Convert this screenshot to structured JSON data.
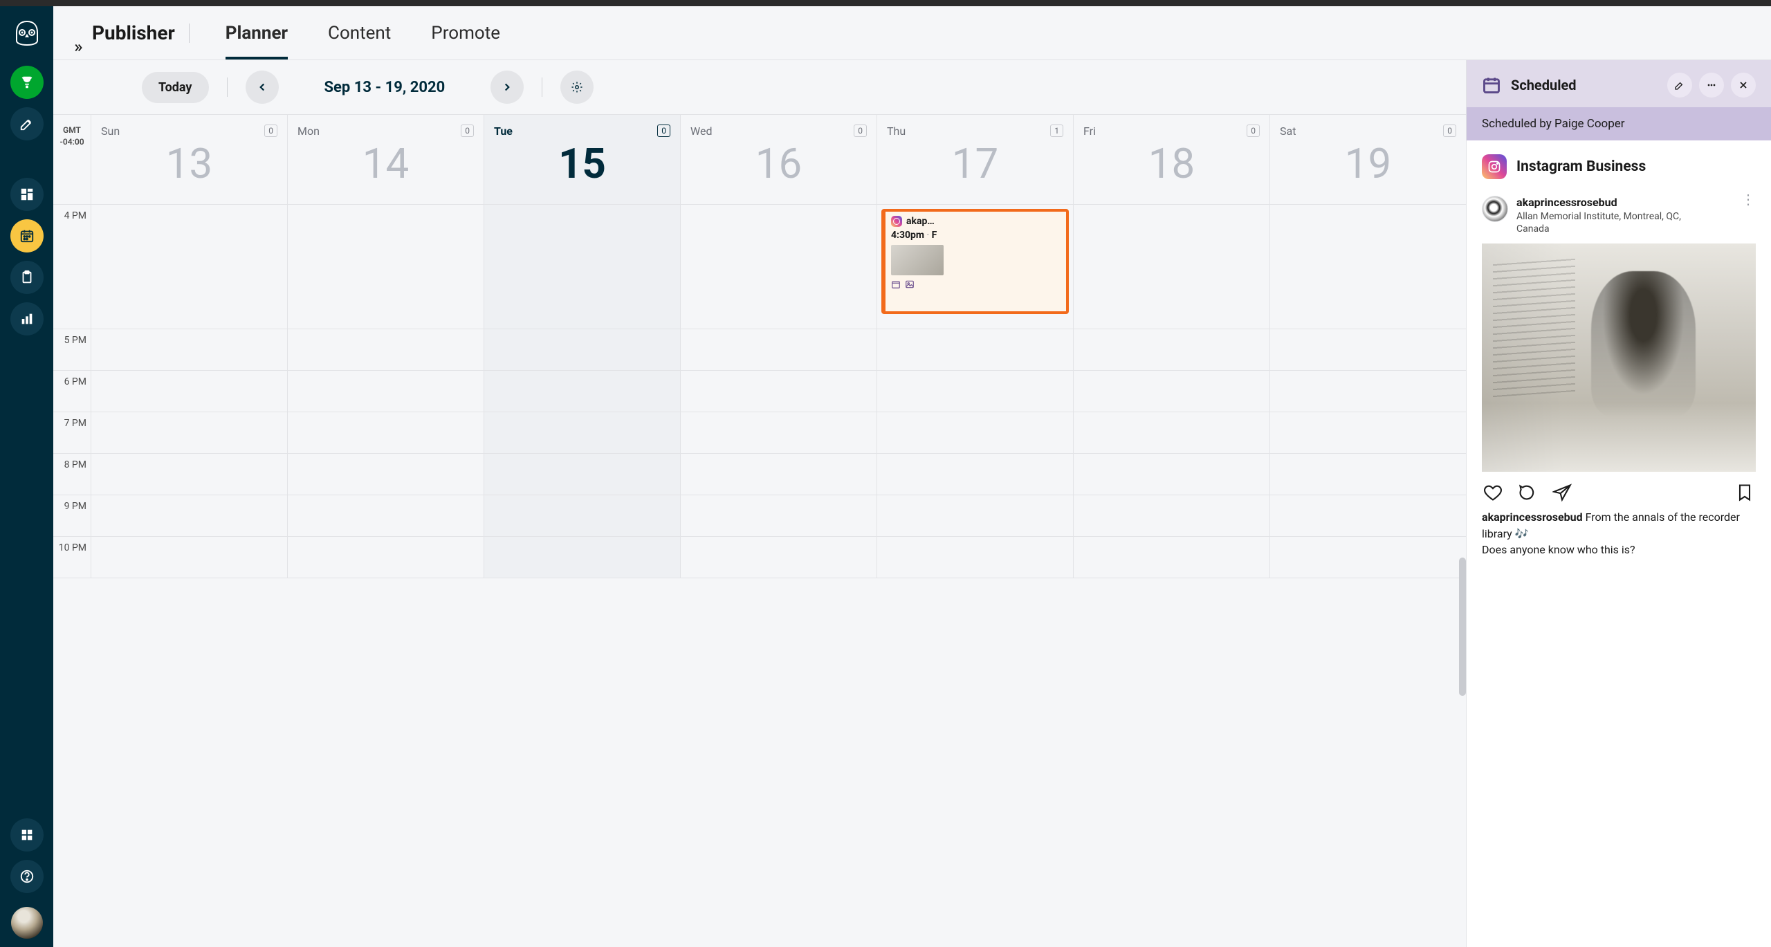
{
  "header": {
    "app_title": "Publisher",
    "tabs": [
      {
        "label": "Planner",
        "active": true
      },
      {
        "label": "Content",
        "active": false
      },
      {
        "label": "Promote",
        "active": false
      }
    ]
  },
  "toolbar": {
    "today_label": "Today",
    "date_range": "Sep 13 - 19, 2020"
  },
  "timezone": {
    "label": "GMT",
    "offset": "-04:00"
  },
  "days": [
    {
      "name": "Sun",
      "num": "13",
      "count": "0",
      "today": false
    },
    {
      "name": "Mon",
      "num": "14",
      "count": "0",
      "today": false
    },
    {
      "name": "Tue",
      "num": "15",
      "count": "0",
      "today": true
    },
    {
      "name": "Wed",
      "num": "16",
      "count": "0",
      "today": false
    },
    {
      "name": "Thu",
      "num": "17",
      "count": "1",
      "today": false
    },
    {
      "name": "Fri",
      "num": "18",
      "count": "0",
      "today": false
    },
    {
      "name": "Sat",
      "num": "19",
      "count": "0",
      "today": false
    }
  ],
  "hours": [
    "4 PM",
    "5 PM",
    "6 PM",
    "7 PM",
    "8 PM",
    "9 PM",
    "10 PM"
  ],
  "event": {
    "account_short": "akap…",
    "time": "4:30pm",
    "sep": " · ",
    "tail": "F"
  },
  "panel": {
    "status": "Scheduled",
    "subheader": "Scheduled by Paige Cooper",
    "network": "Instagram Business",
    "username": "akaprincessrosebud",
    "location": "Allan Memorial Institute, Montreal, QC, Canada",
    "caption_user": "akaprincessrosebud",
    "caption_text_1": "  From the annals of the recorder library 🎶",
    "caption_text_2": "Does anyone know who this is?"
  }
}
